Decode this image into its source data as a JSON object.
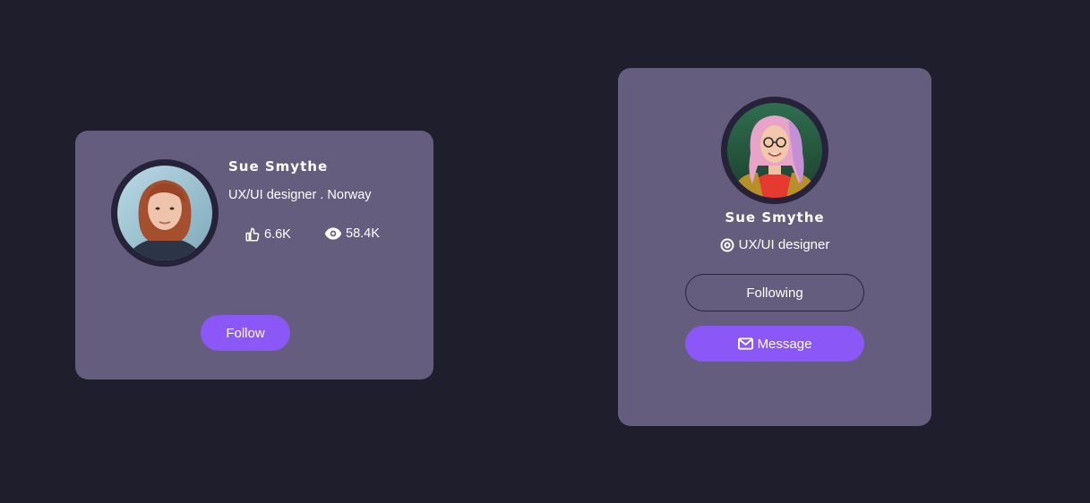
{
  "card_horizontal": {
    "name": "Sue Smythe",
    "role": "UX/UI designer . Norway",
    "likes": "6.6K",
    "views": "58.4K",
    "follow_label": "Follow",
    "avatar_icon": "portrait-red-hair-woman"
  },
  "card_vertical": {
    "name": "Sue Smythe",
    "role": "UX/UI designer",
    "following_label": "Following",
    "message_label": "Message",
    "avatar_icon": "portrait-pink-hair-woman-glasses"
  },
  "colors": {
    "background": "#1f1e2d",
    "card": "#655d7d",
    "accent": "#8b57f7",
    "avatar_ring": "#25223a"
  }
}
